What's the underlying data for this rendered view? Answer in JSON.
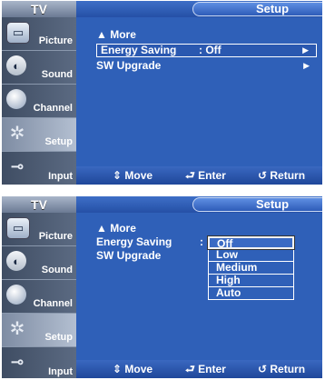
{
  "screens": [
    {
      "tv_label": "TV",
      "title": "Setup",
      "sidebar": [
        {
          "label": "Picture",
          "icon": "picture-icon"
        },
        {
          "label": "Sound",
          "icon": "sound-icon"
        },
        {
          "label": "Channel",
          "icon": "channel-icon"
        },
        {
          "label": "Setup",
          "icon": "setup-icon"
        },
        {
          "label": "Input",
          "icon": "input-icon"
        }
      ],
      "menu": {
        "more": "▲ More",
        "items": [
          {
            "label": "Energy Saving",
            "value": ": Off",
            "arrow": "▶"
          },
          {
            "label": "SW Upgrade",
            "value": "",
            "arrow": "▶"
          }
        ]
      },
      "footer": {
        "move": "⇕ Move",
        "enter": "⮐ Enter",
        "return": "↺ Return"
      }
    },
    {
      "tv_label": "TV",
      "title": "Setup",
      "sidebar": [
        {
          "label": "Picture",
          "icon": "picture-icon"
        },
        {
          "label": "Sound",
          "icon": "sound-icon"
        },
        {
          "label": "Channel",
          "icon": "channel-icon"
        },
        {
          "label": "Setup",
          "icon": "setup-icon"
        },
        {
          "label": "Input",
          "icon": "input-icon"
        }
      ],
      "menu": {
        "more": "▲ More",
        "items": [
          {
            "label": "Energy Saving",
            "value": ":"
          },
          {
            "label": "SW Upgrade",
            "value": ""
          }
        ],
        "options": [
          "Off",
          "Low",
          "Medium",
          "High",
          "Auto"
        ],
        "selected_option": "Off"
      },
      "footer": {
        "move": "⇕ Move",
        "enter": "⮐ Enter",
        "return": "↺ Return"
      }
    }
  ]
}
